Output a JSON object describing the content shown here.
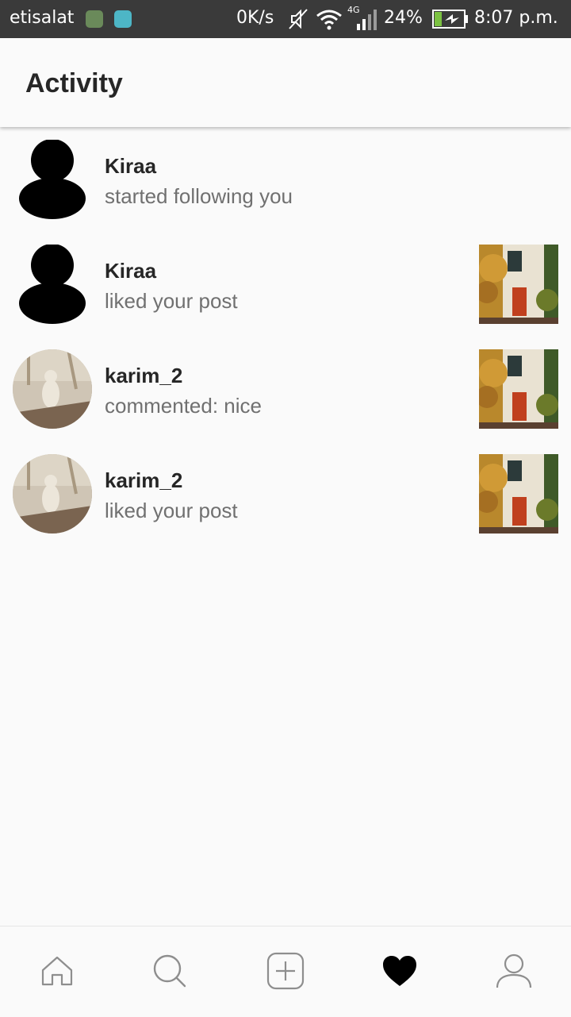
{
  "status_bar": {
    "carrier": "etisalat",
    "network_speed": "0K/s",
    "network_type": "4G",
    "battery": "24%",
    "time": "8:07 p.m."
  },
  "header": {
    "title": "Activity"
  },
  "activity": {
    "items": [
      {
        "username": "Kiraa",
        "text": "started following you",
        "avatar": "silhouette",
        "has_post_thumbnail": false
      },
      {
        "username": "Kiraa",
        "text": "liked your post",
        "avatar": "silhouette",
        "has_post_thumbnail": true
      },
      {
        "username": "karim_2",
        "text": "commented: nice",
        "avatar": "photo",
        "has_post_thumbnail": true
      },
      {
        "username": "karim_2",
        "text": "liked your post",
        "avatar": "photo",
        "has_post_thumbnail": true
      }
    ]
  },
  "bottom_nav": {
    "items": [
      {
        "icon": "home-icon",
        "active": false
      },
      {
        "icon": "search-icon",
        "active": false
      },
      {
        "icon": "add-post-icon",
        "active": false
      },
      {
        "icon": "heart-icon",
        "active": true
      },
      {
        "icon": "profile-icon",
        "active": false
      }
    ]
  }
}
